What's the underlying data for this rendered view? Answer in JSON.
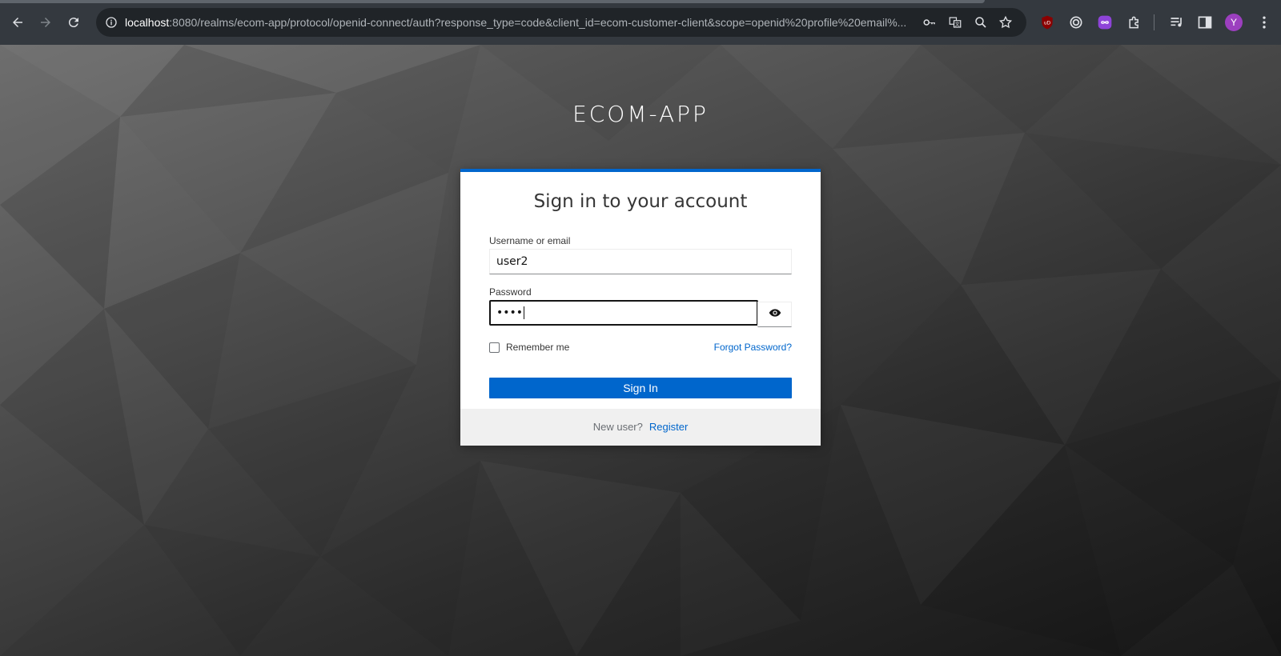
{
  "browser": {
    "url_host": "localhost",
    "url_rest": ":8080/realms/ecom-app/protocol/openid-connect/auth?response_type=code&client_id=ecom-customer-client&scope=openid%20profile%20email%...",
    "profile_initial": "Y",
    "icons": {
      "back": "back-arrow-icon",
      "forward": "forward-arrow-icon",
      "reload": "reload-icon",
      "info": "info-icon",
      "key": "key-icon",
      "translate": "translate-icon",
      "zoom": "zoom-icon",
      "bookmark": "star-icon",
      "ublock": "ublock-icon",
      "ext2": "target-icon",
      "ext3": "infinity-icon",
      "extensions": "puzzle-icon",
      "media": "media-control-icon",
      "sidepanel": "side-panel-icon",
      "menu": "kebab-menu-icon"
    }
  },
  "page": {
    "realm_title": "ECOM-APP",
    "form": {
      "heading": "Sign in to your account",
      "username_label": "Username or email",
      "username_value": "user2",
      "password_label": "Password",
      "password_value": "••••",
      "remember_label": "Remember me",
      "forgot_label": "Forgot Password?",
      "submit_label": "Sign In",
      "new_user_text": "New user?",
      "register_label": "Register"
    }
  },
  "colors": {
    "accent": "#0066cc",
    "toolbar": "#34393f",
    "omnibox": "#202428"
  }
}
